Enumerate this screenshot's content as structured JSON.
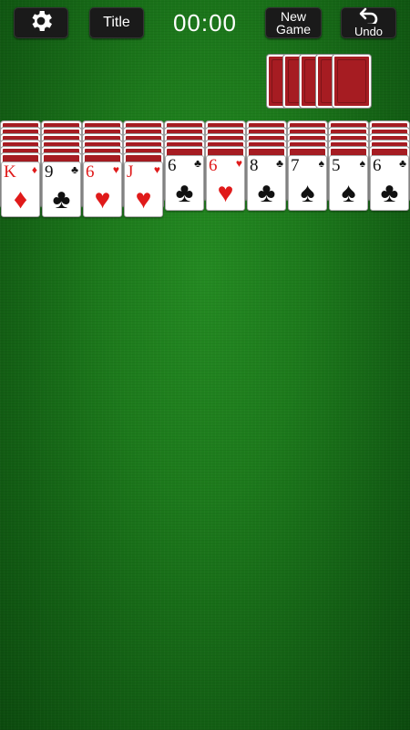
{
  "topbar": {
    "title_label": "Title",
    "timer": "00:00",
    "new_game_line1": "New",
    "new_game_line2": "Game",
    "undo_label": "Undo",
    "settings_icon": "gear-icon",
    "undo_icon": "undo-arrow-icon"
  },
  "stock": {
    "remaining_deals": 5
  },
  "tableau": [
    {
      "rank": "K",
      "suit": "♦",
      "color": "red",
      "hidden": 6
    },
    {
      "rank": "9",
      "suit": "♣",
      "color": "black",
      "hidden": 6
    },
    {
      "rank": "6",
      "suit": "♥",
      "color": "red",
      "hidden": 6
    },
    {
      "rank": "J",
      "suit": "♥",
      "color": "red",
      "hidden": 6
    },
    {
      "rank": "6",
      "suit": "♣",
      "color": "black",
      "hidden": 5
    },
    {
      "rank": "6",
      "suit": "♥",
      "color": "red",
      "hidden": 5
    },
    {
      "rank": "8",
      "suit": "♣",
      "color": "black",
      "hidden": 5
    },
    {
      "rank": "7",
      "suit": "♠",
      "color": "black",
      "hidden": 5
    },
    {
      "rank": "5",
      "suit": "♠",
      "color": "black",
      "hidden": 5
    },
    {
      "rank": "6",
      "suit": "♣",
      "color": "black",
      "hidden": 5
    }
  ],
  "colors": {
    "felt": "#1d7a1c",
    "card_back": "#a61c22",
    "red_suit": "#e01a1a"
  }
}
